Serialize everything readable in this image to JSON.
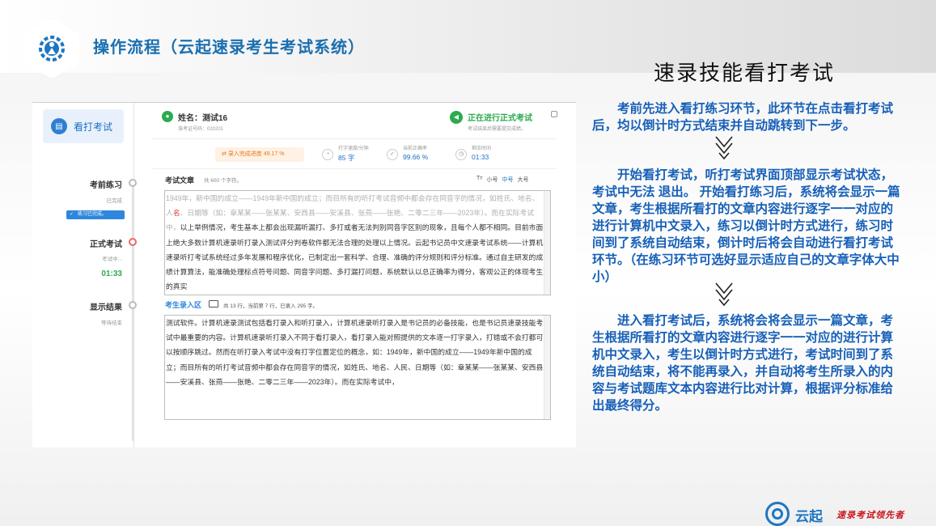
{
  "slide": {
    "title": "操作流程（云起速录考生考试系统）",
    "right_heading": "速录技能看打考试",
    "paragraphs": [
      "考前先进入看打练习环节，此环节在点击看打考试后，均以倒计时方式结束并自动跳转到下一步。",
      "开始看打考试，听打考试界面顶部显示考试状态，考试中无法 退出。 开始看打练习后，系统将会显示一篇文章，考生根据所看打的文章内容进行逐字一一对应的进行计算机中文录入，练习以倒计时方式进行，练习时间到了系统自动结束，倒计时后将会自动进行看打考试环节。（在练习环节可选好显示适应自己的文章字体大中小）",
      "进入看打考试后，系统将会将会显示一篇文章，考生根据所看打的文章内容进行逐字一一对应的进行计算机中文录入，考生以倒计时方式进行，考试时间到了系统自动结束，将不能再录入，并自动将考生所录入的内容与考试题库文本内容进行比对计算，根据评分标准给出最终得分。"
    ],
    "brand": "云起",
    "slogan": "速录考试领先者"
  },
  "app": {
    "sidebar": {
      "exam_button": "看打考试",
      "steps": [
        {
          "title": "考前练习",
          "status": "已完成",
          "tag": "练习已完成。"
        },
        {
          "title": "正式考试",
          "status": "考试中...",
          "timer": "01:33"
        },
        {
          "title": "显示结果",
          "status": "等待结束"
        }
      ]
    },
    "header": {
      "name": "姓名：测试16",
      "ticket": "准考证号码：020201",
      "status_title": "正在进行正式考试",
      "status_sub": "考试结束后需要提交成绩。"
    },
    "stats": {
      "progress_label": "录入完成进度 49.17 %",
      "items": [
        {
          "label": "打字速度/分钟",
          "value": "85 字",
          "icon": "speed-icon"
        },
        {
          "label": "当前正确率",
          "value": "99.66 %",
          "icon": "check-icon"
        },
        {
          "label": "剩余时间",
          "value": "01:33",
          "icon": "clock-icon"
        }
      ]
    },
    "article": {
      "title": "考试文章",
      "count": "共 600 个字符。",
      "font_size_icon": "Tт",
      "sizes": [
        "小号",
        "中号",
        "大号"
      ],
      "ref_grey_1": "1949年，新中国的成立——1949年新中国的成立；而目所有的听打考试音频中都会存在同音字的情况，如姓氏、地名、人",
      "ref_red": "名",
      "ref_grey_2": "、日期等（如：章某某——张某某、安西县——安溪县、张燕——张艳、二零二三年——2023年）。而在实际考试中，",
      "ref_dark": "以上举例情况，考生基本上都会出现漏听漏打、多打或者无法判别同音字区别的现象，且每个人都不相同。目前市面上绝大多数计算机速录听打录入测试评分判卷软件都无法合理的处理以上情况。云起书记员中文速录考试系统——计算机速录听打考试系统经过多年发展和程序优化，已制定出一套科学、合理、准确的评分规则和评分标准。通过自主研发的成绩计算算法，能准确处理标点符号问题、同音字问题、多打漏打问题，系统默认以总正确率为得分，客观公正的体现考生的真实"
    },
    "input": {
      "label": "考生录入区",
      "info": "共 13 行，当前第 7 行，已录入 295 字。",
      "text": "测试软件。计算机速录测试包括看打录入和听打录入，计算机速录听打录入是书记员的必备技能，也是书记员速录技能考试中最重要的内容。计算机速录听打录入不同于看打录入，看打录入能对照提供的文本逐一打字录入，打错或不会打都可以按顺序跳过。然而在听打录入考试中没有打字位置定位的概念，如：1949年，新中国的成立——1949年新中国的成立；而目所有的听打考试音频中都会存在同音字的情况，如姓氏、地名、人民、日期等（如：章某某——张某某、安西县——安溪县、张燕——张艳、二零二三年——2023年）。而在实际考试中，"
    }
  }
}
